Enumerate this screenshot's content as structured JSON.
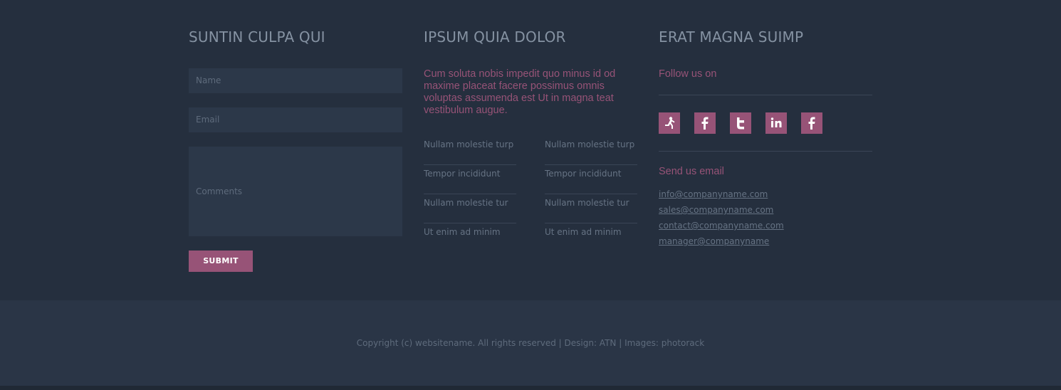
{
  "contact_form": {
    "heading": "SUNTIN CULPA QUI",
    "name_placeholder": "Name",
    "email_placeholder": "Email",
    "comments_placeholder": "Comments",
    "submit_label": "SUBMIT"
  },
  "about": {
    "heading": "IPSUM QUIA DOLOR",
    "lead": "Cum soluta nobis impedit quo minus id od maxime placeat facere possimus omnis voluptas assumenda est Ut in magna teat vestibulum augue.",
    "links_left": [
      "Nullam molestie turp",
      "Tempor incididunt",
      "Nullam molestie tur",
      "Ut enim ad minim"
    ],
    "links_right": [
      "Nullam molestie turp",
      "Tempor incididunt",
      "Nullam molestie tur",
      "Ut enim ad minim"
    ]
  },
  "social_col": {
    "heading": "ERAT MAGNA SUIMP",
    "follow_label": "Follow us on",
    "icons": [
      "runner-icon",
      "facebook-icon",
      "twitter-icon",
      "linkedin-icon",
      "facebook-icon"
    ],
    "send_label": "Send us email",
    "emails": [
      "info@companyname.com",
      "sales@companyname.com",
      "contact@companyname.com",
      "manager@companyname"
    ]
  },
  "footer": {
    "copyright": "Copyright (c) websitename. All rights reserved | Design: ATN | Images: photorack"
  },
  "colors": {
    "background": "#252f3e",
    "footer_background": "#2a3546",
    "accent": "#975377",
    "heading": "#8592a2"
  }
}
